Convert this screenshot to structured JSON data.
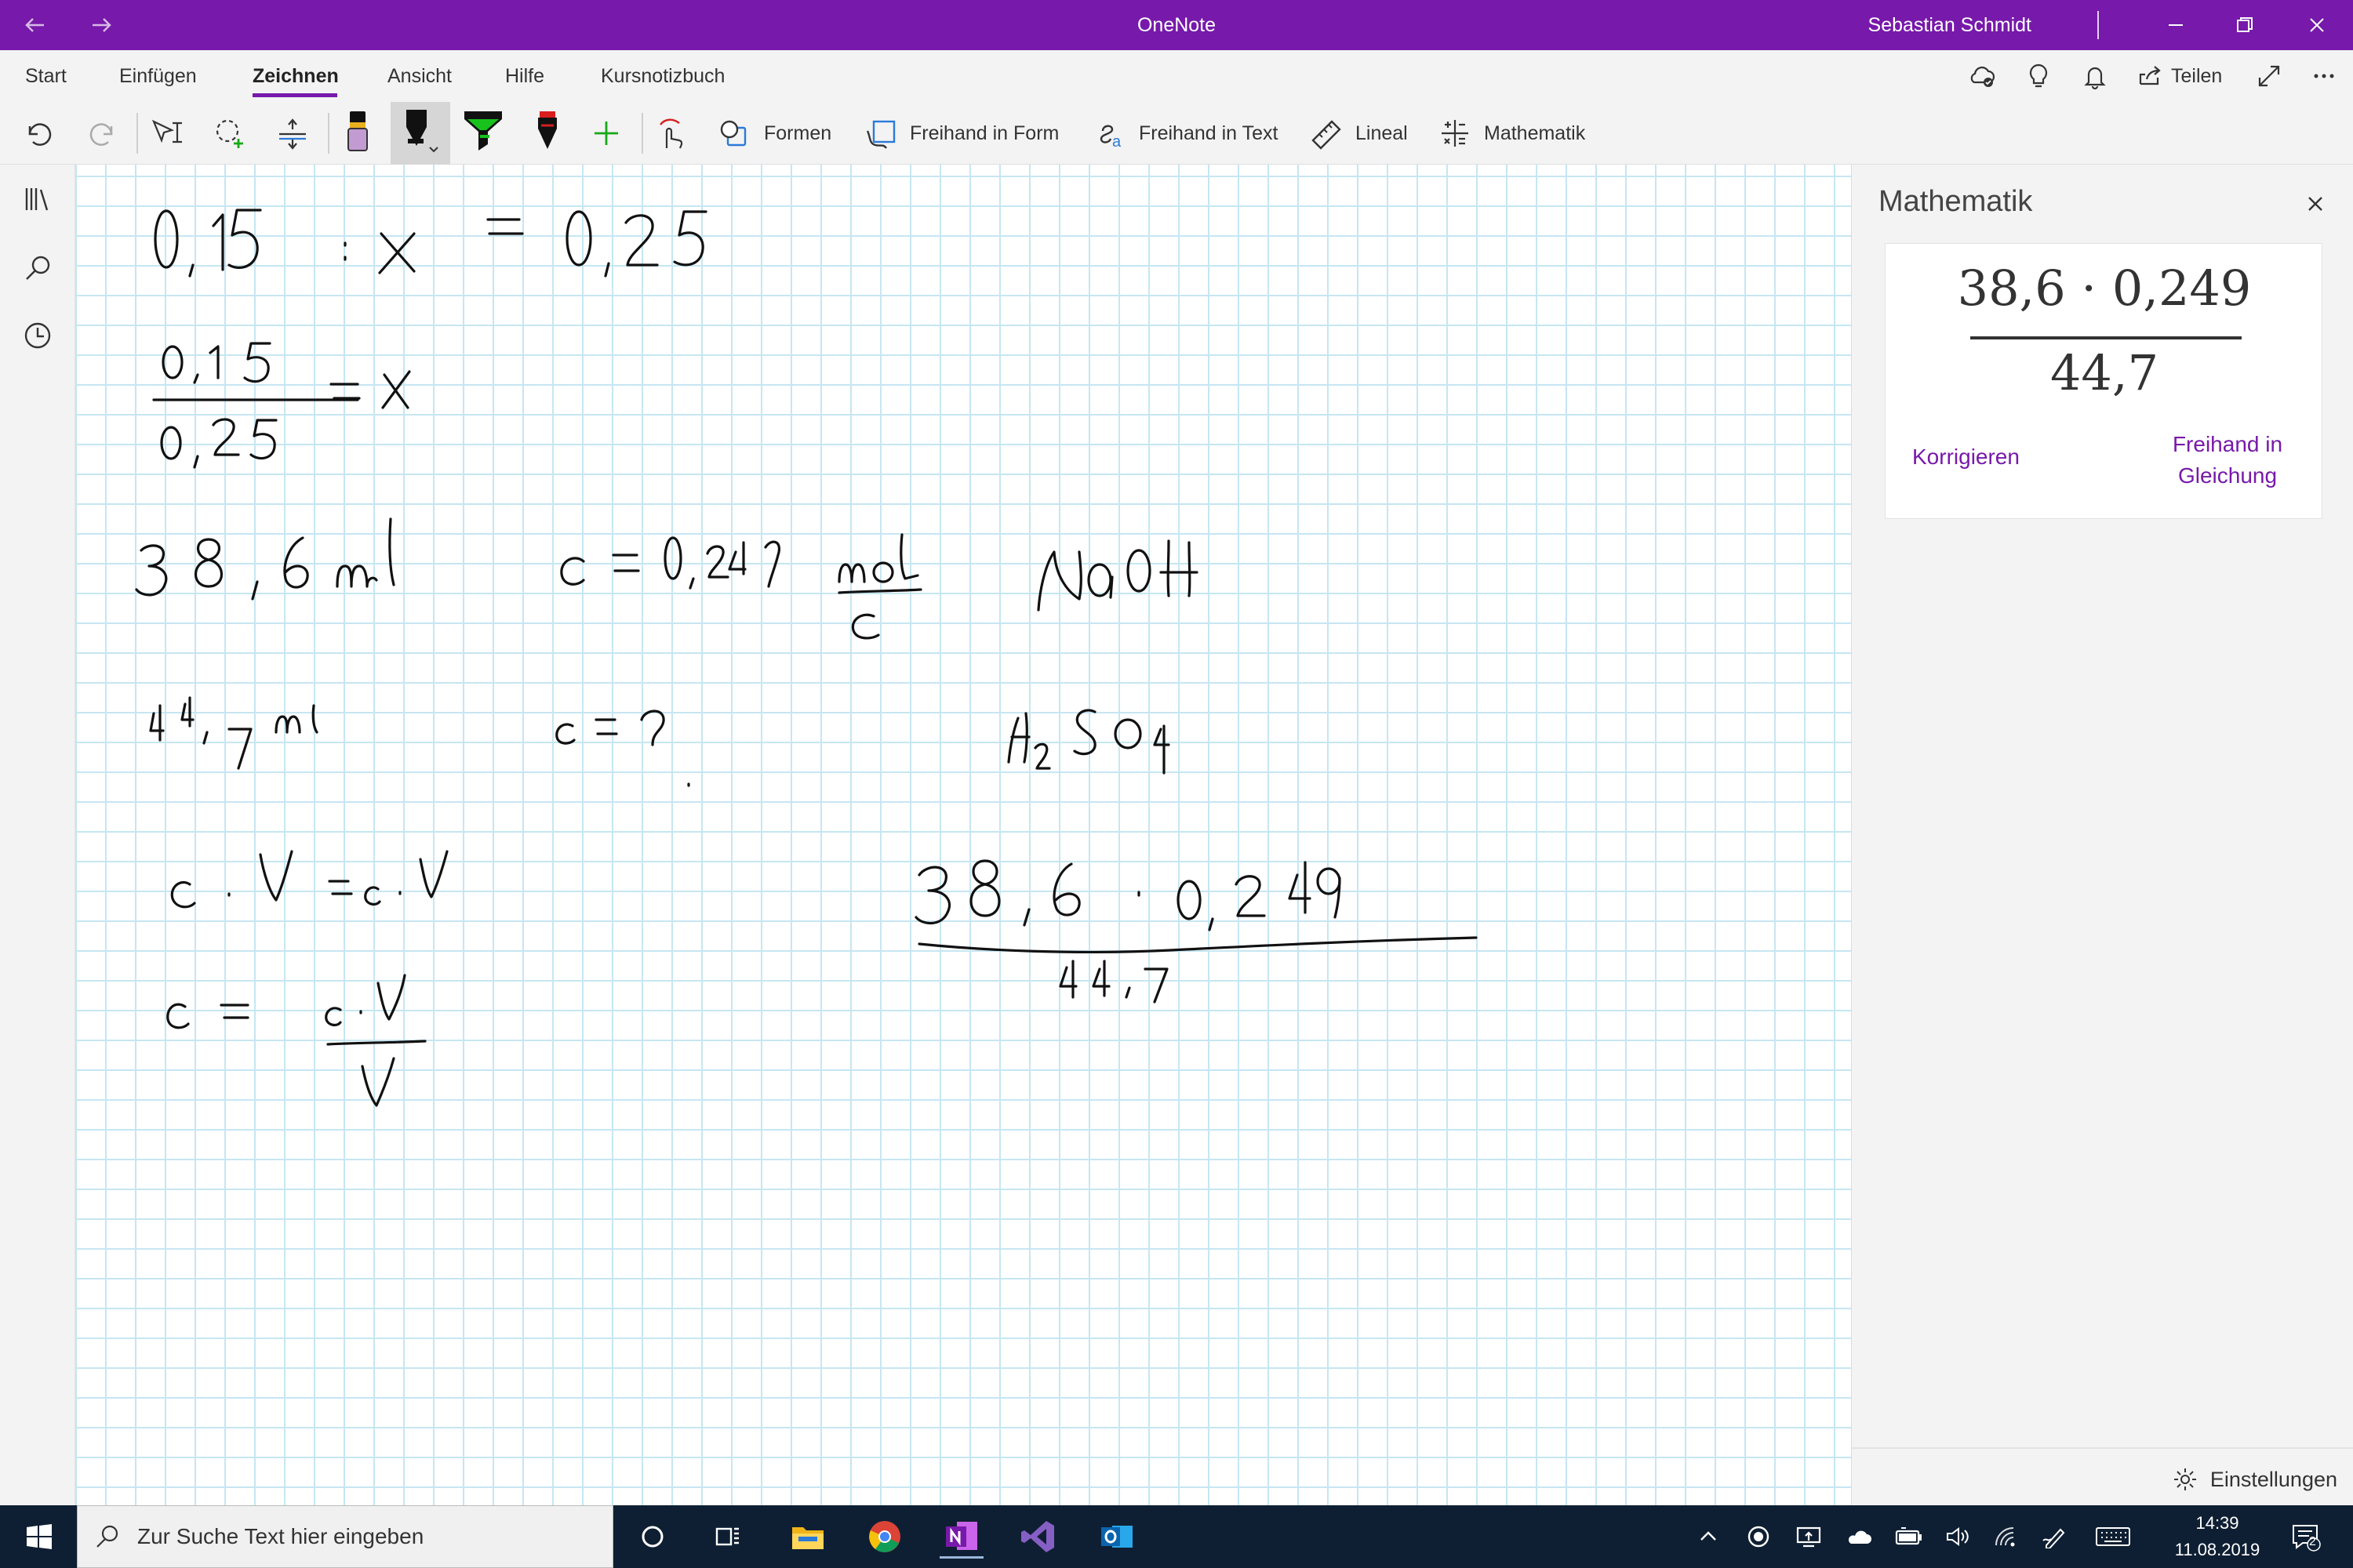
{
  "titlebar": {
    "app_title": "OneNote",
    "user_name": "Sebastian Schmidt",
    "accent": "#7719aa"
  },
  "menu": {
    "items": [
      "Start",
      "Einfügen",
      "Zeichnen",
      "Ansicht",
      "Hilfe",
      "Kursnotizbuch"
    ],
    "active": "Zeichnen",
    "share_label": "Teilen"
  },
  "toolbar": {
    "shapes": "Formen",
    "ink_to_shape": "Freihand in Form",
    "ink_to_text": "Freihand in Text",
    "ruler": "Lineal",
    "math": "Mathematik",
    "pen_colors": [
      "#c39bd3",
      "#111111",
      "#18c21c",
      "#d81e1e"
    ]
  },
  "panel": {
    "title": "Mathematik",
    "equation_numerator": "38,6 · 0,249",
    "equation_denominator": "44,7",
    "correct_label": "Korrigieren",
    "ink_to_equation_label": "Freihand in Gleichung",
    "settings_label": "Einstellungen"
  },
  "taskbar": {
    "search_placeholder": "Zur Suche Text hier eingeben",
    "time": "14:39",
    "date": "11.08.2019",
    "notification_count": "2"
  }
}
